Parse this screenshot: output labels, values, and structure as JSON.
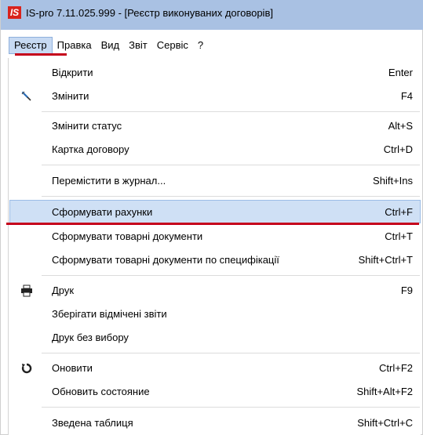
{
  "window": {
    "title": "IS-pro 7.11.025.999 - [Реєстр виконуваних договорів]",
    "logo_text": "IS"
  },
  "menubar": {
    "items": [
      {
        "label": "Реєстр",
        "active": true
      },
      {
        "label": "Правка",
        "active": false
      },
      {
        "label": "Вид",
        "active": false
      },
      {
        "label": "Звіт",
        "active": false
      },
      {
        "label": "Сервіс",
        "active": false
      },
      {
        "label": "?",
        "active": false
      }
    ]
  },
  "dropdown": {
    "items": [
      {
        "label": "Відкрити",
        "shortcut": "Enter",
        "icon": null
      },
      {
        "label": "Змінити",
        "shortcut": "F4",
        "icon": "edit-icon"
      },
      {
        "label": "Змінити статус",
        "shortcut": "Alt+S",
        "icon": null
      },
      {
        "label": "Картка договору",
        "shortcut": "Ctrl+D",
        "icon": null
      },
      {
        "label": "Перемістити в журнал...",
        "shortcut": "Shift+Ins",
        "icon": null
      },
      {
        "label": "Сформувати рахунки",
        "shortcut": "Ctrl+F",
        "icon": null,
        "highlighted": true
      },
      {
        "label": "Сформувати товарні документи",
        "shortcut": "Ctrl+T",
        "icon": null
      },
      {
        "label": "Сформувати товарні документи по специфікації",
        "shortcut": "Shift+Ctrl+T",
        "icon": null
      },
      {
        "label": "Друк",
        "shortcut": "F9",
        "icon": "printer-icon"
      },
      {
        "label": "Зберігати відмічені звіти",
        "shortcut": "",
        "icon": null
      },
      {
        "label": "Друк без вибору",
        "shortcut": "",
        "icon": null
      },
      {
        "label": "Оновити",
        "shortcut": "Ctrl+F2",
        "icon": "refresh-icon"
      },
      {
        "label": "Обновить состояние",
        "shortcut": "Shift+Alt+F2",
        "icon": null
      },
      {
        "label": "Зведена таблиця",
        "shortcut": "Shift+Ctrl+C",
        "icon": null
      }
    ]
  },
  "colors": {
    "titlebar": "#a9c1e3",
    "highlight": "#cfe0f5",
    "annotation_red": "#c5001b",
    "logo_red": "#d9221c"
  }
}
